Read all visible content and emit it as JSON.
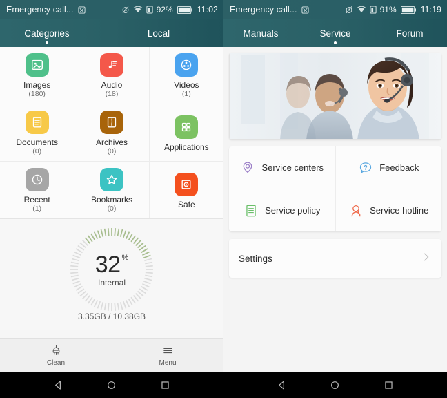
{
  "left": {
    "statusbar": {
      "carrier": "Emergency call...",
      "sim_icon": "sim-card-icon",
      "alarm_icon": "alarm-off-icon",
      "wifi_icon": "wifi-icon",
      "signal_icon": "signal-no-service-icon",
      "battery_pct": "92%",
      "battery_icon": "battery-icon",
      "time": "11:02"
    },
    "tabs": [
      {
        "label": "Categories",
        "active": true
      },
      {
        "label": "Local",
        "active": false
      }
    ],
    "categories": [
      {
        "label": "Images",
        "count": "(180)",
        "icon": "image-icon",
        "color": "#4fc08a"
      },
      {
        "label": "Audio",
        "count": "(18)",
        "icon": "music-note-icon",
        "color": "#f4584a"
      },
      {
        "label": "Videos",
        "count": "(1)",
        "icon": "film-reel-icon",
        "color": "#4aa3ef"
      },
      {
        "label": "Documents",
        "count": "(0)",
        "icon": "document-icon",
        "color": "#f7c948"
      },
      {
        "label": "Archives",
        "count": "(0)",
        "icon": "archive-zip-icon",
        "color": "#a8640a"
      },
      {
        "label": "Applications",
        "count": "",
        "icon": "apps-grid-icon",
        "color": "#7cc262"
      },
      {
        "label": "Recent",
        "count": "(1)",
        "icon": "clock-icon",
        "color": "#a6a6a6"
      },
      {
        "label": "Bookmarks",
        "count": "(0)",
        "icon": "star-icon",
        "color": "#3cc3c3"
      },
      {
        "label": "Safe",
        "count": "",
        "icon": "safe-lock-icon",
        "color": "#f4501e"
      }
    ],
    "storage": {
      "percent": "32",
      "percent_symbol": "%",
      "percent_value": 32,
      "sublabel": "Internal",
      "used_total": "3.35GB / 10.38GB",
      "gauge_fill_color": "#a7bd8e",
      "gauge_track_color": "#dcdcdc"
    },
    "toolbar": [
      {
        "label": "Clean",
        "icon": "brush-icon"
      },
      {
        "label": "Menu",
        "icon": "hamburger-menu-icon"
      }
    ]
  },
  "right": {
    "statusbar": {
      "carrier": "Emergency call...",
      "sim_icon": "sim-card-icon",
      "alarm_icon": "alarm-off-icon",
      "wifi_icon": "wifi-icon",
      "signal_icon": "signal-no-service-icon",
      "battery_pct": "91%",
      "battery_icon": "battery-icon",
      "time": "11:19"
    },
    "tabs": [
      {
        "label": "Manuals",
        "active": false
      },
      {
        "label": "Service",
        "active": true
      },
      {
        "label": "Forum",
        "active": false
      }
    ],
    "banner": {
      "alt": "call center agents wearing headsets"
    },
    "services": [
      {
        "label": "Service centers",
        "icon": "map-pin-icon",
        "color": "#9b7ec7"
      },
      {
        "label": "Feedback",
        "icon": "question-chat-icon",
        "color": "#5aa8e0"
      },
      {
        "label": "Service policy",
        "icon": "policy-doc-icon",
        "color": "#6abf69"
      },
      {
        "label": "Service hotline",
        "icon": "person-call-icon",
        "color": "#ef6a4b"
      }
    ],
    "settings": {
      "label": "Settings",
      "chevron_icon": "chevron-right-icon"
    }
  },
  "navbar": {
    "back_icon": "back-triangle-icon",
    "home_icon": "home-circle-icon",
    "recents_icon": "recents-square-icon"
  },
  "theme": {
    "header_teal": "#2a6066",
    "page_bg": "#f4f4f4",
    "card_bg": "#fcfcfc"
  }
}
